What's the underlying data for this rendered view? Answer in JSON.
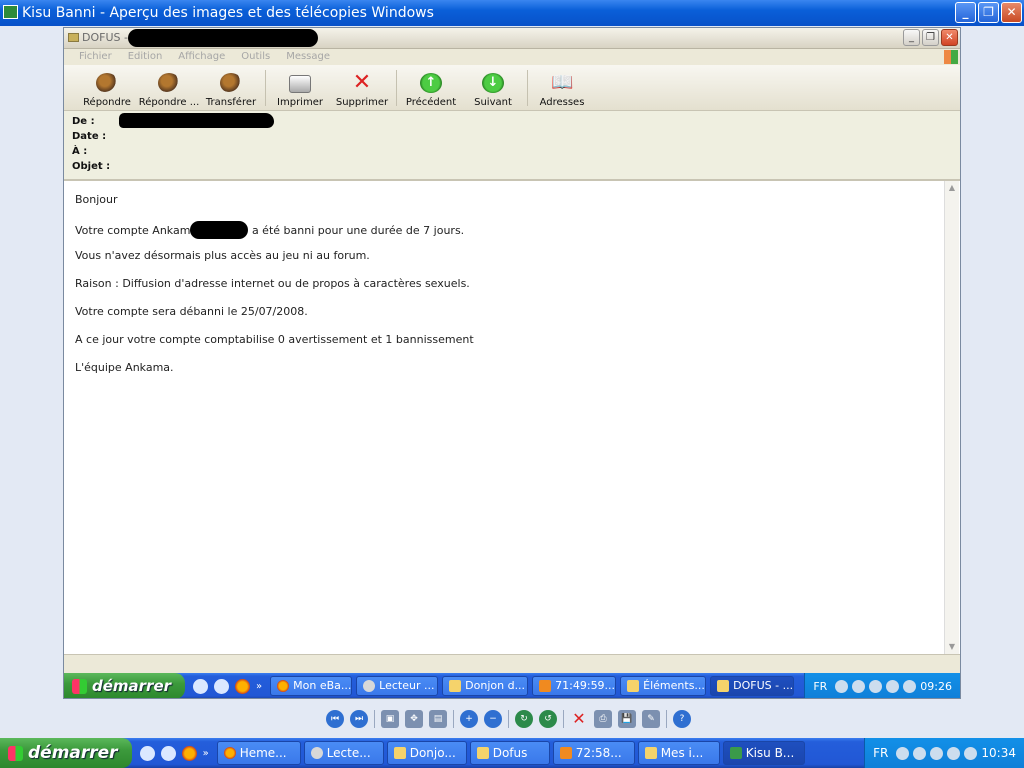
{
  "outer_window": {
    "title": "Kisu Banni - Aperçu des images et des télécopies Windows",
    "controls": [
      "_",
      "❐",
      "✕"
    ]
  },
  "inner_window": {
    "title_prefix": "DOFUS - ",
    "controls": [
      "_",
      "❐",
      "✕"
    ],
    "menu": [
      "Fichier",
      "Edition",
      "Affichage",
      "Outils",
      "Message"
    ],
    "toolbar": {
      "repondre": "Répondre",
      "repondre_tous": "Répondre ...",
      "transferer": "Transférer",
      "imprimer": "Imprimer",
      "supprimer": "Supprimer",
      "precedent": "Précédent",
      "suivant": "Suivant",
      "adresses": "Adresses"
    },
    "headers": {
      "from": "De :",
      "date": "Date :",
      "to": "À :",
      "subject": "Objet :"
    },
    "body": {
      "greeting": "Bonjour",
      "line1_a": "Votre compte Ankam",
      "line1_b": " a été banni pour une durée de 7 jours.",
      "line2": "Vous n'avez désormais plus accès au jeu ni au forum.",
      "line3": "Raison : Diffusion d'adresse internet ou de propos à caractères sexuels.",
      "line4": "Votre compte sera débanni le 25/07/2008.",
      "line5": "A ce jour votre compte comptabilise 0 avertissement et 1 bannissement",
      "signature": "L'équipe Ankama."
    },
    "taskbar": {
      "start": "démarrer",
      "tasks": [
        "Mon eBa...",
        "Lecteur ...",
        "Donjon d...",
        "71:49:59...",
        "Éléments...",
        "DOFUS - ..."
      ],
      "lang": "FR",
      "clock": "09:26"
    }
  },
  "viewer_taskbar": {
    "start": "démarrer",
    "tasks": [
      "Heme...",
      "Lecte...",
      "Donjo...",
      "Dofus",
      "72:58...",
      "Mes i...",
      "Kisu B..."
    ],
    "lang": "FR",
    "clock": "10:34"
  },
  "viewer_tools": [
    "⏮",
    "⏭",
    "▣",
    "✥",
    "▤",
    "+",
    "−",
    "↻",
    "↺",
    "✕",
    "⎙",
    "💾",
    "✎",
    "?"
  ]
}
